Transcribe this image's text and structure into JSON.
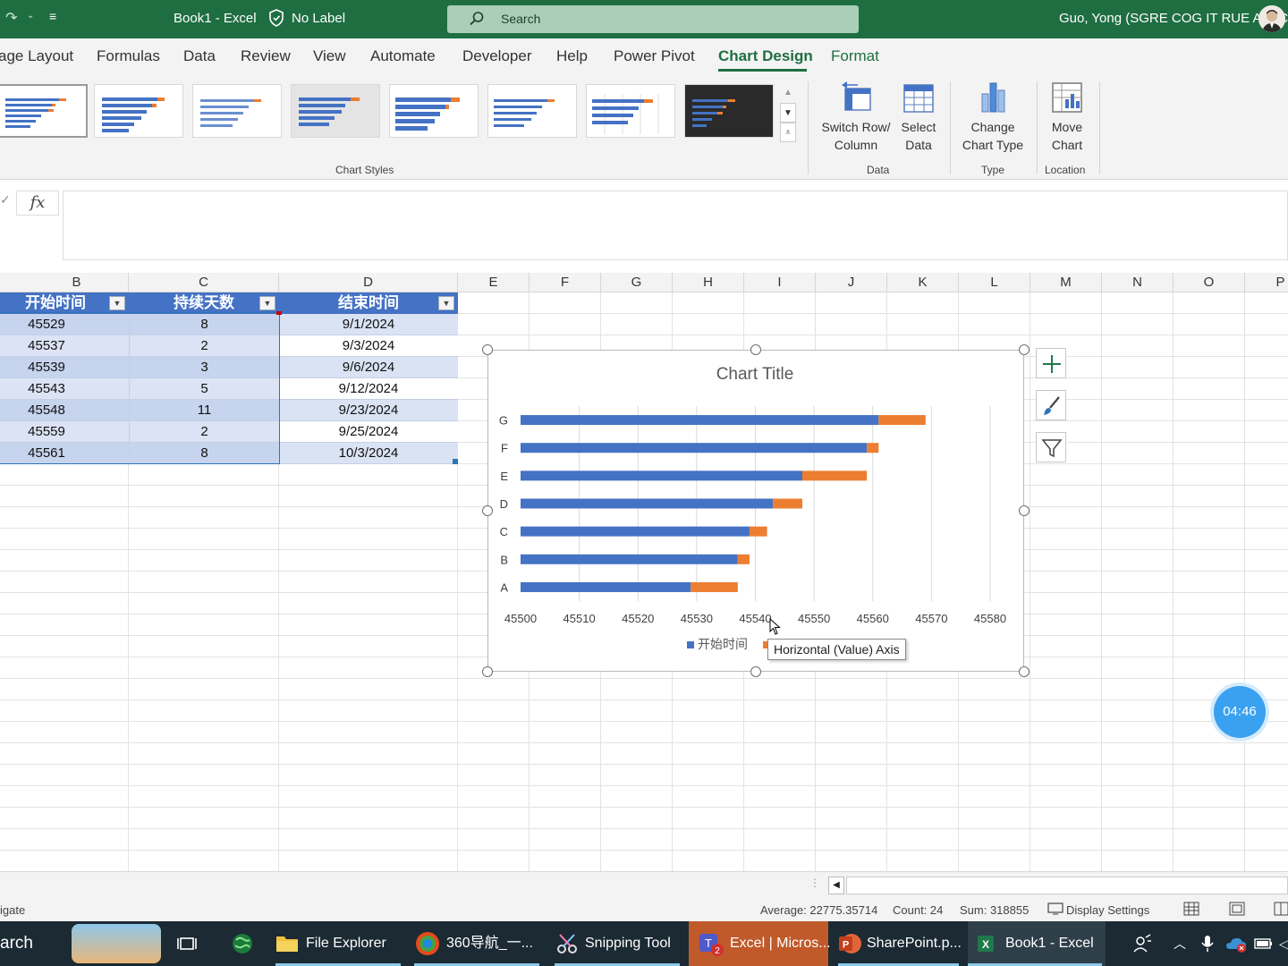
{
  "titlebar": {
    "doc_title": "Book1  -  Excel",
    "sensitivity": "No Label",
    "search_placeholder": "Search",
    "user": "Guo, Yong (SGRE COG IT RUE APAC)"
  },
  "tabs": [
    "age Layout",
    "Formulas",
    "Data",
    "Review",
    "View",
    "Automate",
    "Developer",
    "Help",
    "Power Pivot",
    "Chart Design",
    "Format"
  ],
  "active_tab": "Chart Design",
  "ribbon": {
    "chart_styles_label": "Chart Styles",
    "data_group_label": "Data",
    "type_group_label": "Type",
    "location_group_label": "Location",
    "switch_row_column": [
      "Switch Row/",
      "Column"
    ],
    "select_data": [
      "Select",
      "Data"
    ],
    "change_chart_type": [
      "Change",
      "Chart Type"
    ],
    "move_chart": [
      "Move",
      "Chart"
    ]
  },
  "formula_bar": {
    "fx_label": "fx",
    "content": ""
  },
  "columns": [
    "B",
    "C",
    "D",
    "E",
    "F",
    "G",
    "H",
    "I",
    "J",
    "K",
    "L",
    "M",
    "N",
    "O",
    "P"
  ],
  "table": {
    "headers": [
      "开始时间",
      "持续天数",
      "结束时间"
    ],
    "rows": [
      [
        "45529",
        "8",
        "9/1/2024"
      ],
      [
        "45537",
        "2",
        "9/3/2024"
      ],
      [
        "45539",
        "3",
        "9/6/2024"
      ],
      [
        "45543",
        "5",
        "9/12/2024"
      ],
      [
        "45548",
        "11",
        "9/23/2024"
      ],
      [
        "45559",
        "2",
        "9/25/2024"
      ],
      [
        "45561",
        "8",
        "10/3/2024"
      ]
    ]
  },
  "chart_data": {
    "type": "bar",
    "stacked": true,
    "orientation": "horizontal",
    "title": "Chart Title",
    "categories": [
      "A",
      "B",
      "C",
      "D",
      "E",
      "F",
      "G"
    ],
    "series": [
      {
        "name": "开始时间",
        "values": [
          45529,
          45537,
          45539,
          45543,
          45548,
          45559,
          45561
        ],
        "color": "#4472c4"
      },
      {
        "values": [
          8,
          2,
          3,
          5,
          11,
          2,
          8
        ],
        "color": "#ed7d31"
      }
    ],
    "xlim": [
      45500,
      45580
    ],
    "xticks": [
      45500,
      45510,
      45520,
      45530,
      45540,
      45550,
      45560,
      45570,
      45580
    ],
    "legend": "bottom",
    "gridlines": "vertical"
  },
  "tooltip": "Horizontal (Value) Axis",
  "timer": "04:46",
  "status": {
    "left": "igate",
    "average": "Average: 22775.35714",
    "count": "Count: 24",
    "sum": "Sum: 318855",
    "display_settings": "Display Settings"
  },
  "taskbar": {
    "search": "arch",
    "items": [
      "File Explorer",
      "360导航_一...",
      "Snipping Tool",
      "Excel | Micros...",
      "SharePoint.p...",
      "Book1 - Excel"
    ]
  },
  "colors": {
    "excel_green": "#1e6e42",
    "table_header": "#4472c4",
    "series_orange": "#ed7d31"
  }
}
